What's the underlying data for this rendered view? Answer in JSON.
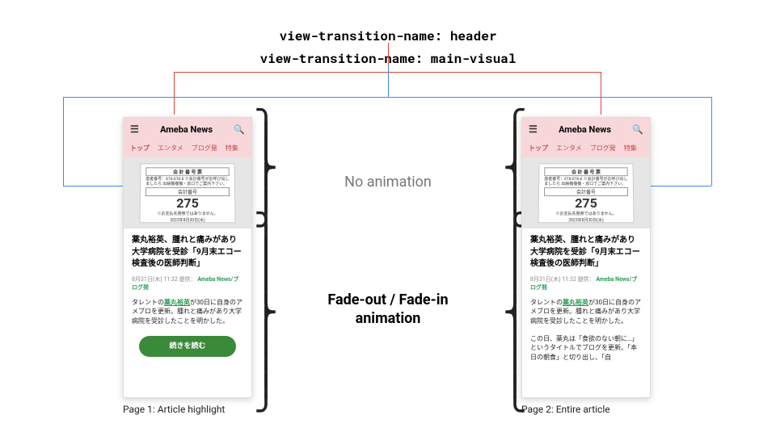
{
  "labels": {
    "vtn_header": "view-transition-name: header",
    "vtn_mainvisual": "view-transition-name: main-visual",
    "no_animation": "No animation",
    "fade_animation": "Fade-out / Fade-in animation"
  },
  "captions": {
    "page1": "Page 1: Article highlight",
    "page2": "Page 2: Entire article"
  },
  "colors": {
    "red": "#DB4437",
    "blue": "#4285F4",
    "header_bg": "#f8d7da",
    "cta": "#3a8a3a",
    "source_green": "#2a9d56"
  },
  "phone": {
    "brand": "Ameba News",
    "tabs": [
      "トップ",
      "エンタメ",
      "ブログ発",
      "特集"
    ],
    "ticket": {
      "title": "会 計 番 号 票",
      "rows": "患者番号：616-616-6\n※会計番号がお呼び出しましたら\n出納機複機・窓口でご案内下さい。",
      "mid_label": "会計番号",
      "number": "275",
      "foot1": "※お支払先発券ではありません。",
      "foot2": "2023年8月30日(水)"
    },
    "article": {
      "title": "薬丸裕英、腫れと痛みがあり大学病院を受診「9月末エコー検査後の医師判断」",
      "meta_time": "8月31日(木) 11:32",
      "meta_provider": "提供：",
      "meta_source": "Ameba News/ブログ発",
      "body_prefix": "タレントの",
      "body_highlight": "薬丸裕英",
      "body_rest": "が30日に自身のアメブロを更新。腫れと痛みがあり大学病院を受診したことを明かした。",
      "cta": "続きを読む",
      "body_extra": "この日、薬丸は「食欲のない朝に…」というタイトルでブログを更新。「本日の朝食」と切り出し、「自"
    }
  }
}
